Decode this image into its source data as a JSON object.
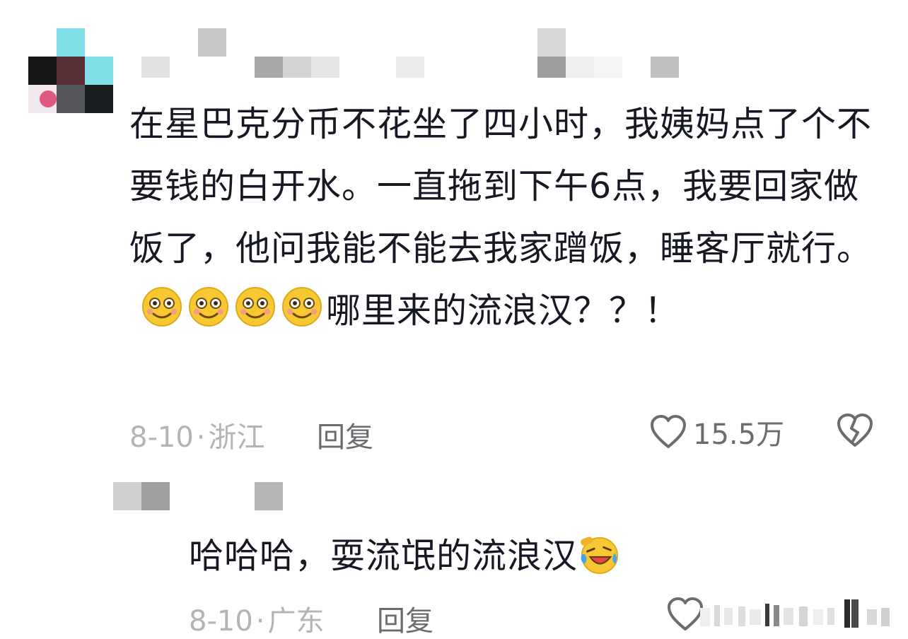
{
  "comment": {
    "text_before_emoji": "在星巴克分币不花坐了四小时，我姨妈点了个不要钱的白开水。一直拖到下午6点，我要回家做饭了，他问我能不能去我家蹭饭，睡客厅就行。",
    "emojis": [
      "smile-emoji",
      "smile-emoji",
      "smile-emoji",
      "smile-emoji"
    ],
    "text_after_emoji": "哪里来的流浪汉？？！",
    "date": "8-10",
    "dot": "·",
    "location": "浙江",
    "reply_label": "回复",
    "like_count": "15.5万",
    "like_icon": "heart-outline-icon",
    "dislike_icon": "broken-heart-icon"
  },
  "reply": {
    "text": "哈哈哈，耍流氓的流浪汉",
    "emoji": "laugh-cry-emoji",
    "date": "8-10",
    "dot": "·",
    "location": "广东",
    "reply_label": "回复",
    "like_icon": "heart-outline-icon"
  },
  "colors": {
    "text": "#161823",
    "meta": "#b4b4b8",
    "action": "#6b6b70",
    "emoji_yellow": "#f7c832"
  }
}
